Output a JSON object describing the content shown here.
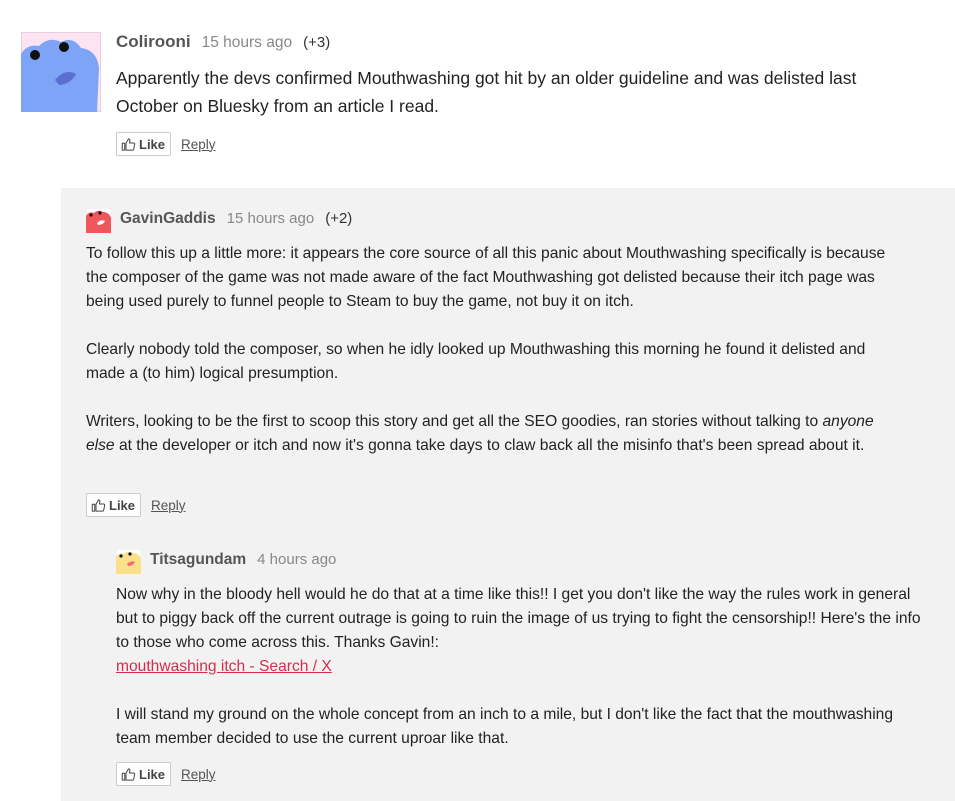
{
  "comments": [
    {
      "author": "Colirooni",
      "time": "15 hours ago",
      "votes": "(+3)",
      "paragraphs": [
        "Apparently the devs confirmed Mouthwashing got hit by an older guideline and was delisted last October on Bluesky from an article I read."
      ],
      "like_label": "Like",
      "reply_label": "Reply",
      "avatar_colors": {
        "bg": "#fde4f3",
        "blob": "#7ea4f7",
        "mouth": "#5a6fd1"
      }
    },
    {
      "author": "GavinGaddis",
      "time": "15 hours ago",
      "votes": "(+2)",
      "paragraph1": "To follow this up a little more: it appears the core source of all this panic about Mouthwashing specifically is because the composer of the game was not made aware of the fact Mouthwashing got delisted because their itch page was being used purely to funnel people to Steam to buy the game, not buy it on itch.",
      "paragraph2": "Clearly nobody told the composer, so when he idly looked up Mouthwashing this morning he found it delisted and made a (to him) logical presumption.",
      "paragraph3_start": "Writers, looking to be the first to scoop this story and get all the SEO goodies, ran stories without talking to ",
      "paragraph3_em": "anyone else",
      "paragraph3_end": " at the developer or itch and now it's gonna take days to claw back all the misinfo that's been spread about it.",
      "like_label": "Like",
      "reply_label": "Reply",
      "avatar_colors": {
        "bg": "#ffffff",
        "blob": "#f0575a",
        "mouth": "#ffffff"
      }
    },
    {
      "author": "Titsagundam",
      "time": "4 hours ago",
      "paragraph1_text": "Now why in the bloody hell would he do that at a time like this!! I get you don't like the way the rules work in general but to piggy back off the current outrage is going to ruin the image of us trying to fight the censorship!! Here's the info to those who come across this. Thanks Gavin!:",
      "link_text": "mouthwashing itch - Search / X",
      "paragraph2": "I will stand my ground on the whole concept from an inch to a mile, but I don't like the fact that the mouthwashing team member decided to use the current uproar like that.",
      "like_label": "Like",
      "reply_label": "Reply",
      "avatar_colors": {
        "bg": "#ffffff",
        "blob": "#fae08a",
        "mouth": "#f07070"
      }
    }
  ],
  "colors": {
    "link": "#da2c49",
    "panel_bg": "#f2f2f2",
    "author": "#555555",
    "time": "#888888"
  },
  "icons": [
    "thumbs-up-icon"
  ]
}
